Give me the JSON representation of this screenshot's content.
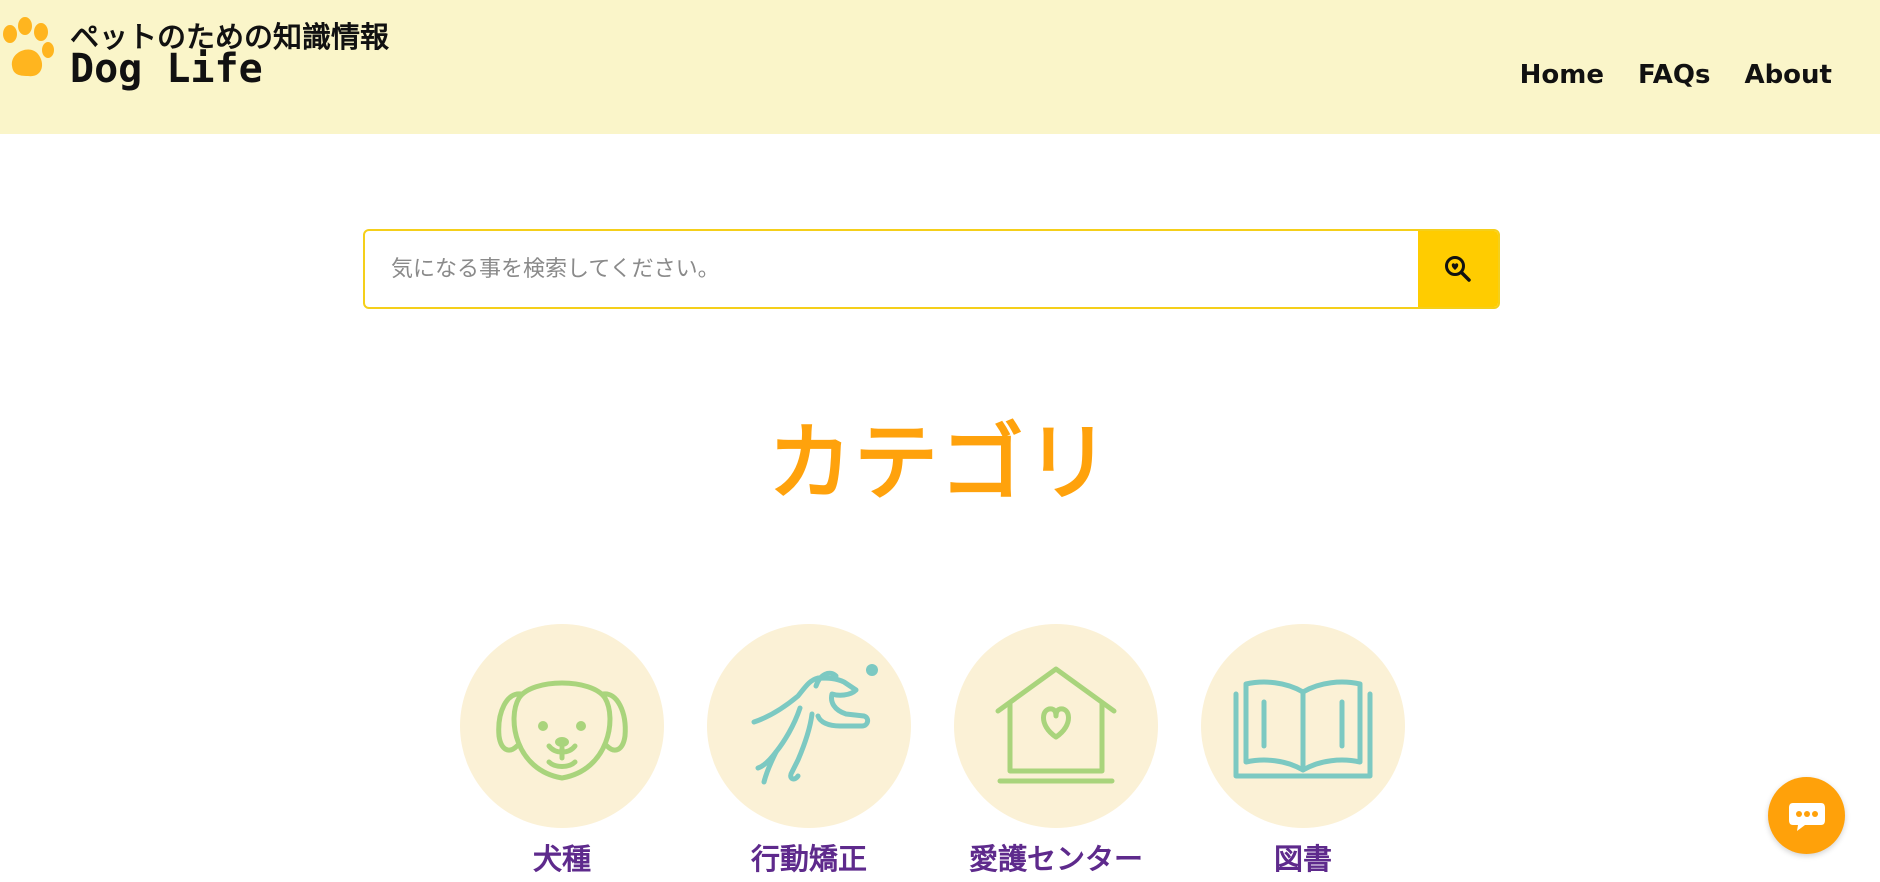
{
  "header": {
    "tagline": "ペットのための知識情報",
    "brand": "Dog Life",
    "nav": [
      "Home",
      "FAQs",
      "About"
    ]
  },
  "search": {
    "placeholder": "気になる事を検索してください。"
  },
  "categories": {
    "title": "カテゴリ",
    "items": [
      {
        "label": "犬種",
        "icon": "dog-face-icon"
      },
      {
        "label": "行動矯正",
        "icon": "jumping-dog-icon"
      },
      {
        "label": "愛護センター",
        "icon": "heart-house-icon"
      },
      {
        "label": "図書",
        "icon": "open-book-icon"
      }
    ]
  },
  "colors": {
    "header_bg": "#faf5c9",
    "accent_orange": "#ffa20c",
    "search_button": "#ffcc00",
    "category_label": "#5e2a8c",
    "icon_green": "#a9d47c",
    "icon_teal": "#7cc9c2"
  }
}
